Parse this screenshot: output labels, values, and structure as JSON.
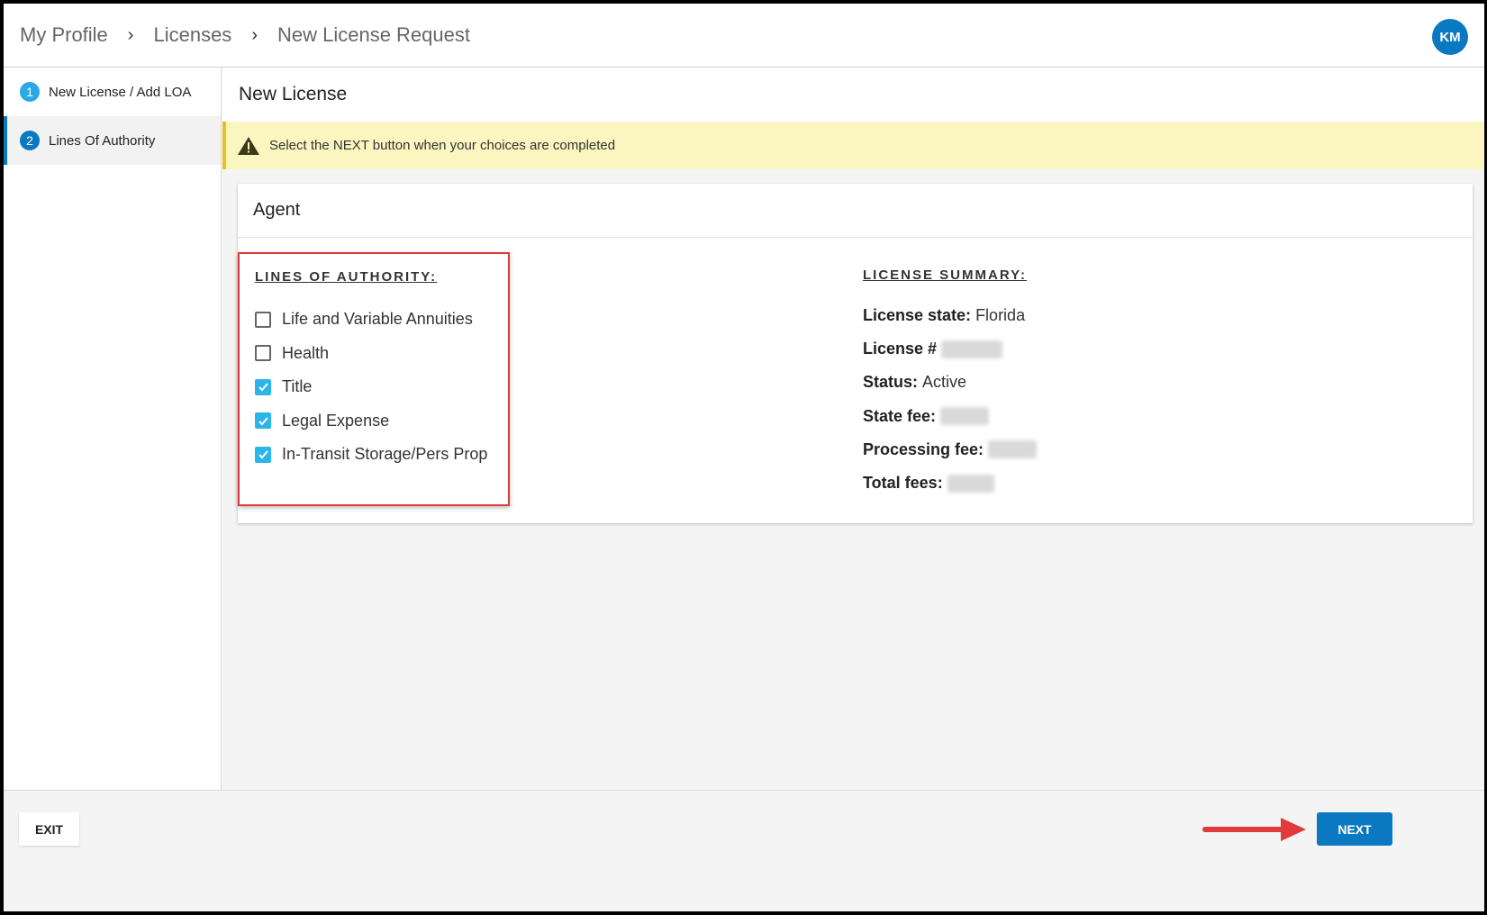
{
  "header": {
    "breadcrumb": [
      "My Profile",
      "Licenses",
      "New License Request"
    ],
    "avatar_initials": "KM"
  },
  "sidebar": {
    "steps": [
      {
        "number": "1",
        "label": "New License / Add LOA"
      },
      {
        "number": "2",
        "label": "Lines Of Authority"
      }
    ]
  },
  "main": {
    "title": "New License",
    "alert_text": "Select the NEXT button when your choices are completed",
    "card_title": "Agent",
    "lines_of_authority": {
      "heading": "LINES OF AUTHORITY:",
      "items": [
        {
          "label": "Life and Variable Annuities",
          "checked": false
        },
        {
          "label": "Health",
          "checked": false
        },
        {
          "label": "Title",
          "checked": true
        },
        {
          "label": "Legal Expense",
          "checked": true
        },
        {
          "label": "In-Transit Storage/Pers Prop",
          "checked": true
        }
      ]
    },
    "license_summary": {
      "heading": "LICENSE SUMMARY:",
      "state_label": "License state:",
      "state_value": "Florida",
      "license_label": "License #",
      "status_label": "Status:",
      "status_value": "Active",
      "state_fee_label": "State fee:",
      "processing_fee_label": "Processing fee:",
      "total_fees_label": "Total fees:"
    }
  },
  "footer": {
    "exit_label": "EXIT",
    "next_label": "NEXT"
  },
  "colors": {
    "accent": "#0a79c2",
    "checkbox_checked": "#2bb5e8",
    "alert_bg": "#fbf5bf",
    "highlight_box": "#e03a3a",
    "arrow": "#e03a3a"
  }
}
